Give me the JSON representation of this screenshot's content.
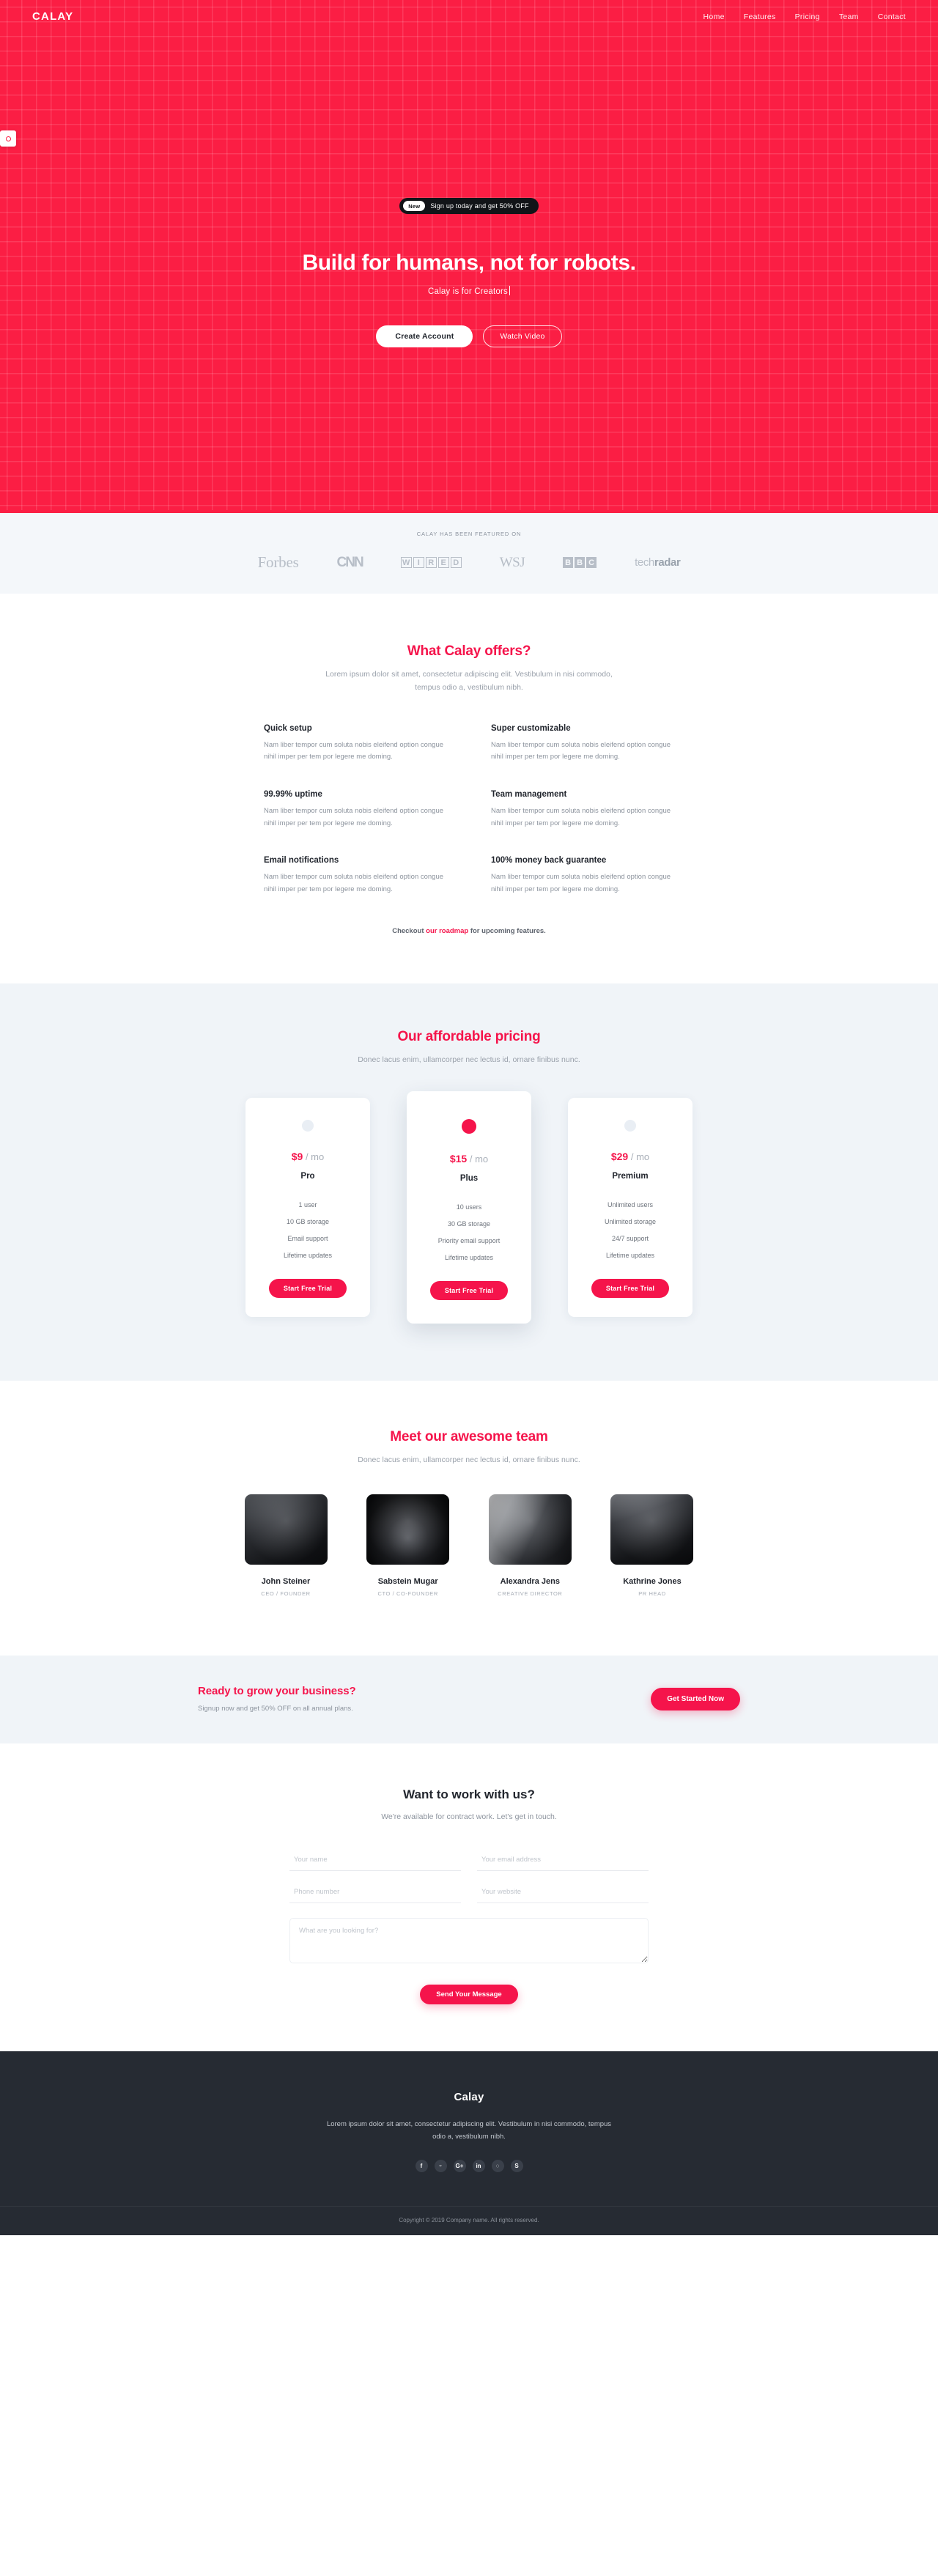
{
  "nav": {
    "logo": "CALAY",
    "links": [
      {
        "label": "Home"
      },
      {
        "label": "Features"
      },
      {
        "label": "Pricing"
      },
      {
        "label": "Team"
      },
      {
        "label": "Contact"
      }
    ]
  },
  "hero": {
    "badge_new": "New",
    "badge_text": "Sign up today and get 50% OFF",
    "headline": "Build for humans, not for robots.",
    "typed": "Calay is for Creators",
    "primary_button": "Create Account",
    "secondary_button": "Watch Video",
    "background_color": "#fb1e44"
  },
  "featured": {
    "kicker": "CALAY HAS BEEN FEATURED ON",
    "logos": [
      {
        "name": "Forbes"
      },
      {
        "name": "CNN"
      },
      {
        "name": "WIRED",
        "letters": [
          "W",
          "I",
          "R",
          "E",
          "D"
        ]
      },
      {
        "name": "WSJ"
      },
      {
        "name": "BBC",
        "letters": [
          "B",
          "B",
          "C"
        ]
      },
      {
        "name": "techradar",
        "light": "tech",
        "bold": "radar"
      }
    ]
  },
  "features": {
    "title": "What Calay offers?",
    "subtitle": "Lorem ipsum dolor sit amet, consectetur adipiscing elit. Vestibulum in nisi commodo, tempus odio a, vestibulum nibh.",
    "items": [
      {
        "title": "Quick setup",
        "body": "Nam liber tempor cum soluta nobis eleifend option congue nihil imper per tem por legere me doming."
      },
      {
        "title": "Super customizable",
        "body": "Nam liber tempor cum soluta nobis eleifend option congue nihil imper per tem por legere me doming."
      },
      {
        "title": "99.99% uptime",
        "body": "Nam liber tempor cum soluta nobis eleifend option congue nihil imper per tem por legere me doming."
      },
      {
        "title": "Team management",
        "body": "Nam liber tempor cum soluta nobis eleifend option congue nihil imper per tem por legere me doming."
      },
      {
        "title": "Email notifications",
        "body": "Nam liber tempor cum soluta nobis eleifend option congue nihil imper per tem por legere me doming."
      },
      {
        "title": "100% money back guarantee",
        "body": "Nam liber tempor cum soluta nobis eleifend option congue nihil imper per tem por legere me doming."
      }
    ],
    "roadmap_prefix": "Checkout ",
    "roadmap_link": "our roadmap",
    "roadmap_suffix": " for upcoming features."
  },
  "pricing": {
    "title": "Our affordable pricing",
    "subtitle": "Donec lacus enim, ullamcorper nec lectus id, ornare finibus nunc.",
    "period": "/ mo",
    "plans": [
      {
        "price": "$9",
        "name": "Pro",
        "features": [
          "1 user",
          "10 GB storage",
          "Email support",
          "Lifetime updates"
        ],
        "button": "Start Free Trial",
        "highlighted": false
      },
      {
        "price": "$15",
        "name": "Plus",
        "features": [
          "10 users",
          "30 GB storage",
          "Priority email support",
          "Lifetime updates"
        ],
        "button": "Start Free Trial",
        "highlighted": true
      },
      {
        "price": "$29",
        "name": "Premium",
        "features": [
          "Unlimited users",
          "Unlimited storage",
          "24/7 support",
          "Lifetime updates"
        ],
        "button": "Start Free Trial",
        "highlighted": false
      }
    ]
  },
  "team": {
    "title": "Meet our awesome team",
    "subtitle": "Donec lacus enim, ullamcorper nec lectus id, ornare finibus nunc.",
    "members": [
      {
        "name": "John Steiner",
        "role": "CEO / FOUNDER"
      },
      {
        "name": "Sabstein Mugar",
        "role": "CTO / CO-FOUNDER"
      },
      {
        "name": "Alexandra Jens",
        "role": "CREATIVE DIRECTOR"
      },
      {
        "name": "Kathrine Jones",
        "role": "PR HEAD"
      }
    ]
  },
  "cta": {
    "title": "Ready to grow your business?",
    "subtitle": "Signup now and get 50% OFF on all annual plans.",
    "button": "Get Started Now"
  },
  "contact": {
    "title": "Want to work with us?",
    "subtitle": "We're available for contract work. Let's get in touch.",
    "name_placeholder": "Your name",
    "email_placeholder": "Your email address",
    "phone_placeholder": "Phone number",
    "website_placeholder": "Your website",
    "message_placeholder": "What are you looking for?",
    "submit": "Send Your Message"
  },
  "footer": {
    "brand": "Calay",
    "description": "Lorem ipsum dolor sit amet, consectetur adipiscing elit. Vestibulum in nisi commodo, tempus odio a, vestibulum nibh.",
    "socials": [
      {
        "name": "facebook-icon",
        "glyph": "f"
      },
      {
        "name": "twitter-icon",
        "glyph": "ᵕ"
      },
      {
        "name": "google-plus-icon",
        "glyph": "G+"
      },
      {
        "name": "linkedin-icon",
        "glyph": "in"
      },
      {
        "name": "dribbble-icon",
        "glyph": "◌"
      },
      {
        "name": "skype-icon",
        "glyph": "S"
      }
    ],
    "copyright": "Copyright © 2019 Company name. All rights reserved."
  },
  "theme": {
    "accent": "#f5144b",
    "hero_red": "#fb1e44",
    "footer_dark": "#262b33",
    "light_gray": "#f0f4f8"
  }
}
